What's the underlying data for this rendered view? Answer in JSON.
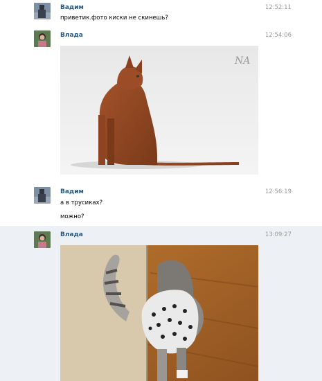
{
  "messages": [
    {
      "author": "Вадим",
      "time": "12:52:11",
      "lines": [
        "приветик.фото киски не скинешь?"
      ]
    },
    {
      "author": "Влада",
      "time": "12:54:06",
      "photo": "cat-photo-abyssinian",
      "watermark": "NA"
    },
    {
      "author": "Вадим",
      "time": "12:56:19",
      "lines": [
        "а в трусиках?",
        "можно?"
      ]
    },
    {
      "author": "Влада",
      "time": "13:09:27",
      "photo": "cat-in-clothes-photo"
    }
  ],
  "colors": {
    "author": "#2b587a",
    "time": "#999999",
    "highlight": "#edf1f5"
  }
}
